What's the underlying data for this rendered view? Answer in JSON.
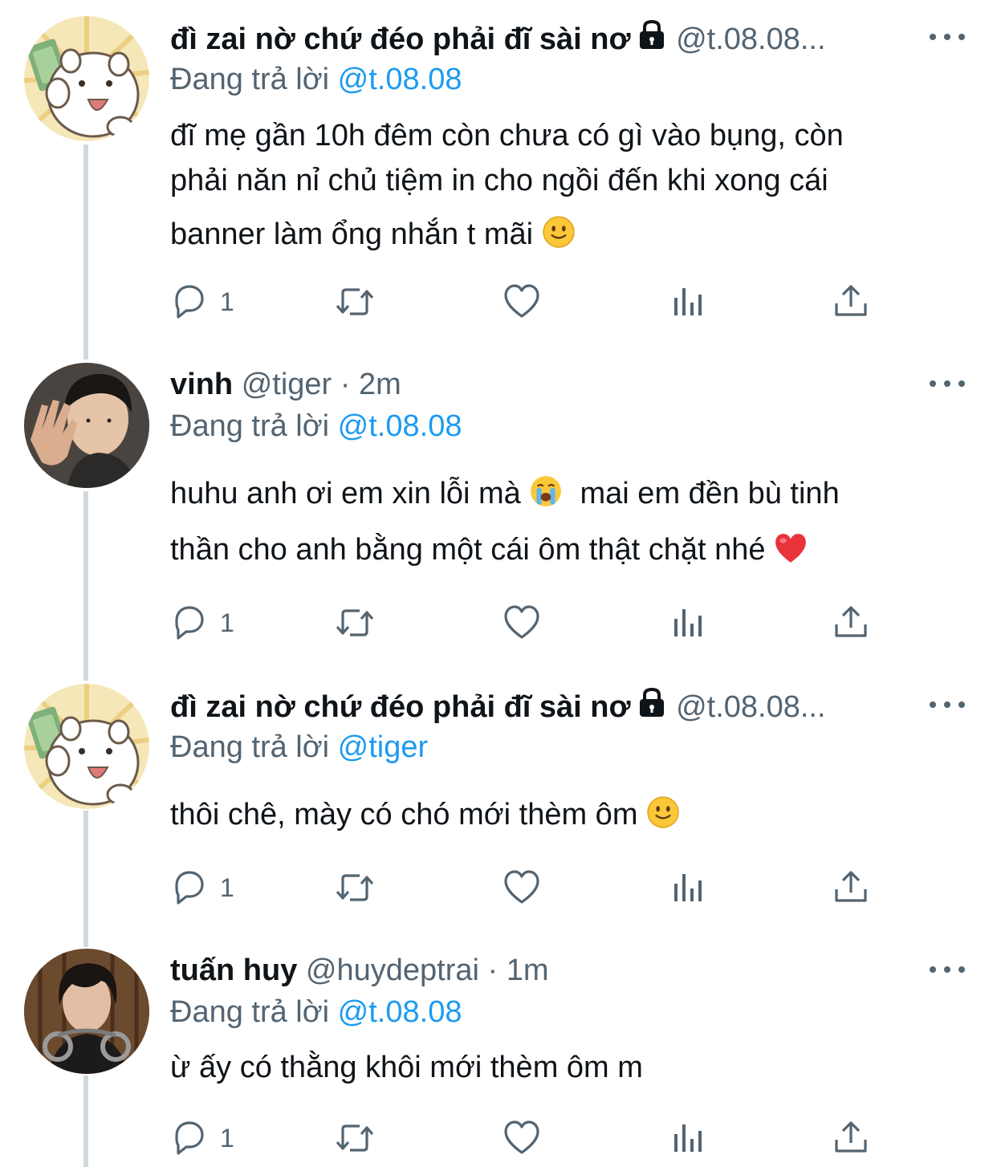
{
  "tweets": [
    {
      "name": "đì zai nờ chứ đéo phải đĩ sài nơ",
      "handle": "@t.08.08...",
      "time": "",
      "replying_label": "Đang trả lời",
      "replying_to": "@t.08.08",
      "text_lines": [
        "đĩ mẹ gần 10h đêm còn chưa có gì vào bụng, còn",
        "phải năn nỉ chủ tiệm in cho ngồi đến khi xong cái",
        "banner làm ổng nhắn t mãi"
      ],
      "emoji": "slightly-smiling-face",
      "reply_count": "1"
    },
    {
      "name": "vinh",
      "handle": "@tiger",
      "dot": "·",
      "time": "2m",
      "replying_label": "Đang trả lời",
      "replying_to": "@t.08.08",
      "text_line1": "huhu anh ơi em xin lỗi mà",
      "text_line1b": "mai em đền bù tinh",
      "text_line2": "thần cho anh bằng một cái ôm thật chặt nhé",
      "emoji1": "loudly-crying-face",
      "emoji2": "red-heart",
      "reply_count": "1"
    },
    {
      "name": "đì zai nờ chứ đéo phải đĩ sài nơ",
      "handle": "@t.08.08...",
      "replying_label": "Đang trả lời",
      "replying_to": "@tiger",
      "text": "thôi chê, mày có chó mới thèm ôm",
      "emoji": "slightly-smiling-face",
      "reply_count": "1"
    },
    {
      "name": "tuấn huy",
      "handle": "@huydeptrai",
      "dot": "·",
      "time": "1m",
      "replying_label": "Đang trả lời",
      "replying_to": "@t.08.08",
      "text": "ừ ấy có thằng khôi mới thèm ôm m",
      "reply_count": "1"
    }
  ],
  "icons": {
    "reply": "reply-icon",
    "retweet": "retweet-icon",
    "like": "heart-icon",
    "views": "views-icon",
    "share": "share-icon",
    "more": "more-icon",
    "lock": "lock-icon"
  },
  "colors": {
    "text": "#0f1419",
    "secondary": "#536471",
    "link": "#1d9bf0",
    "thread_line": "#cfd9de"
  }
}
